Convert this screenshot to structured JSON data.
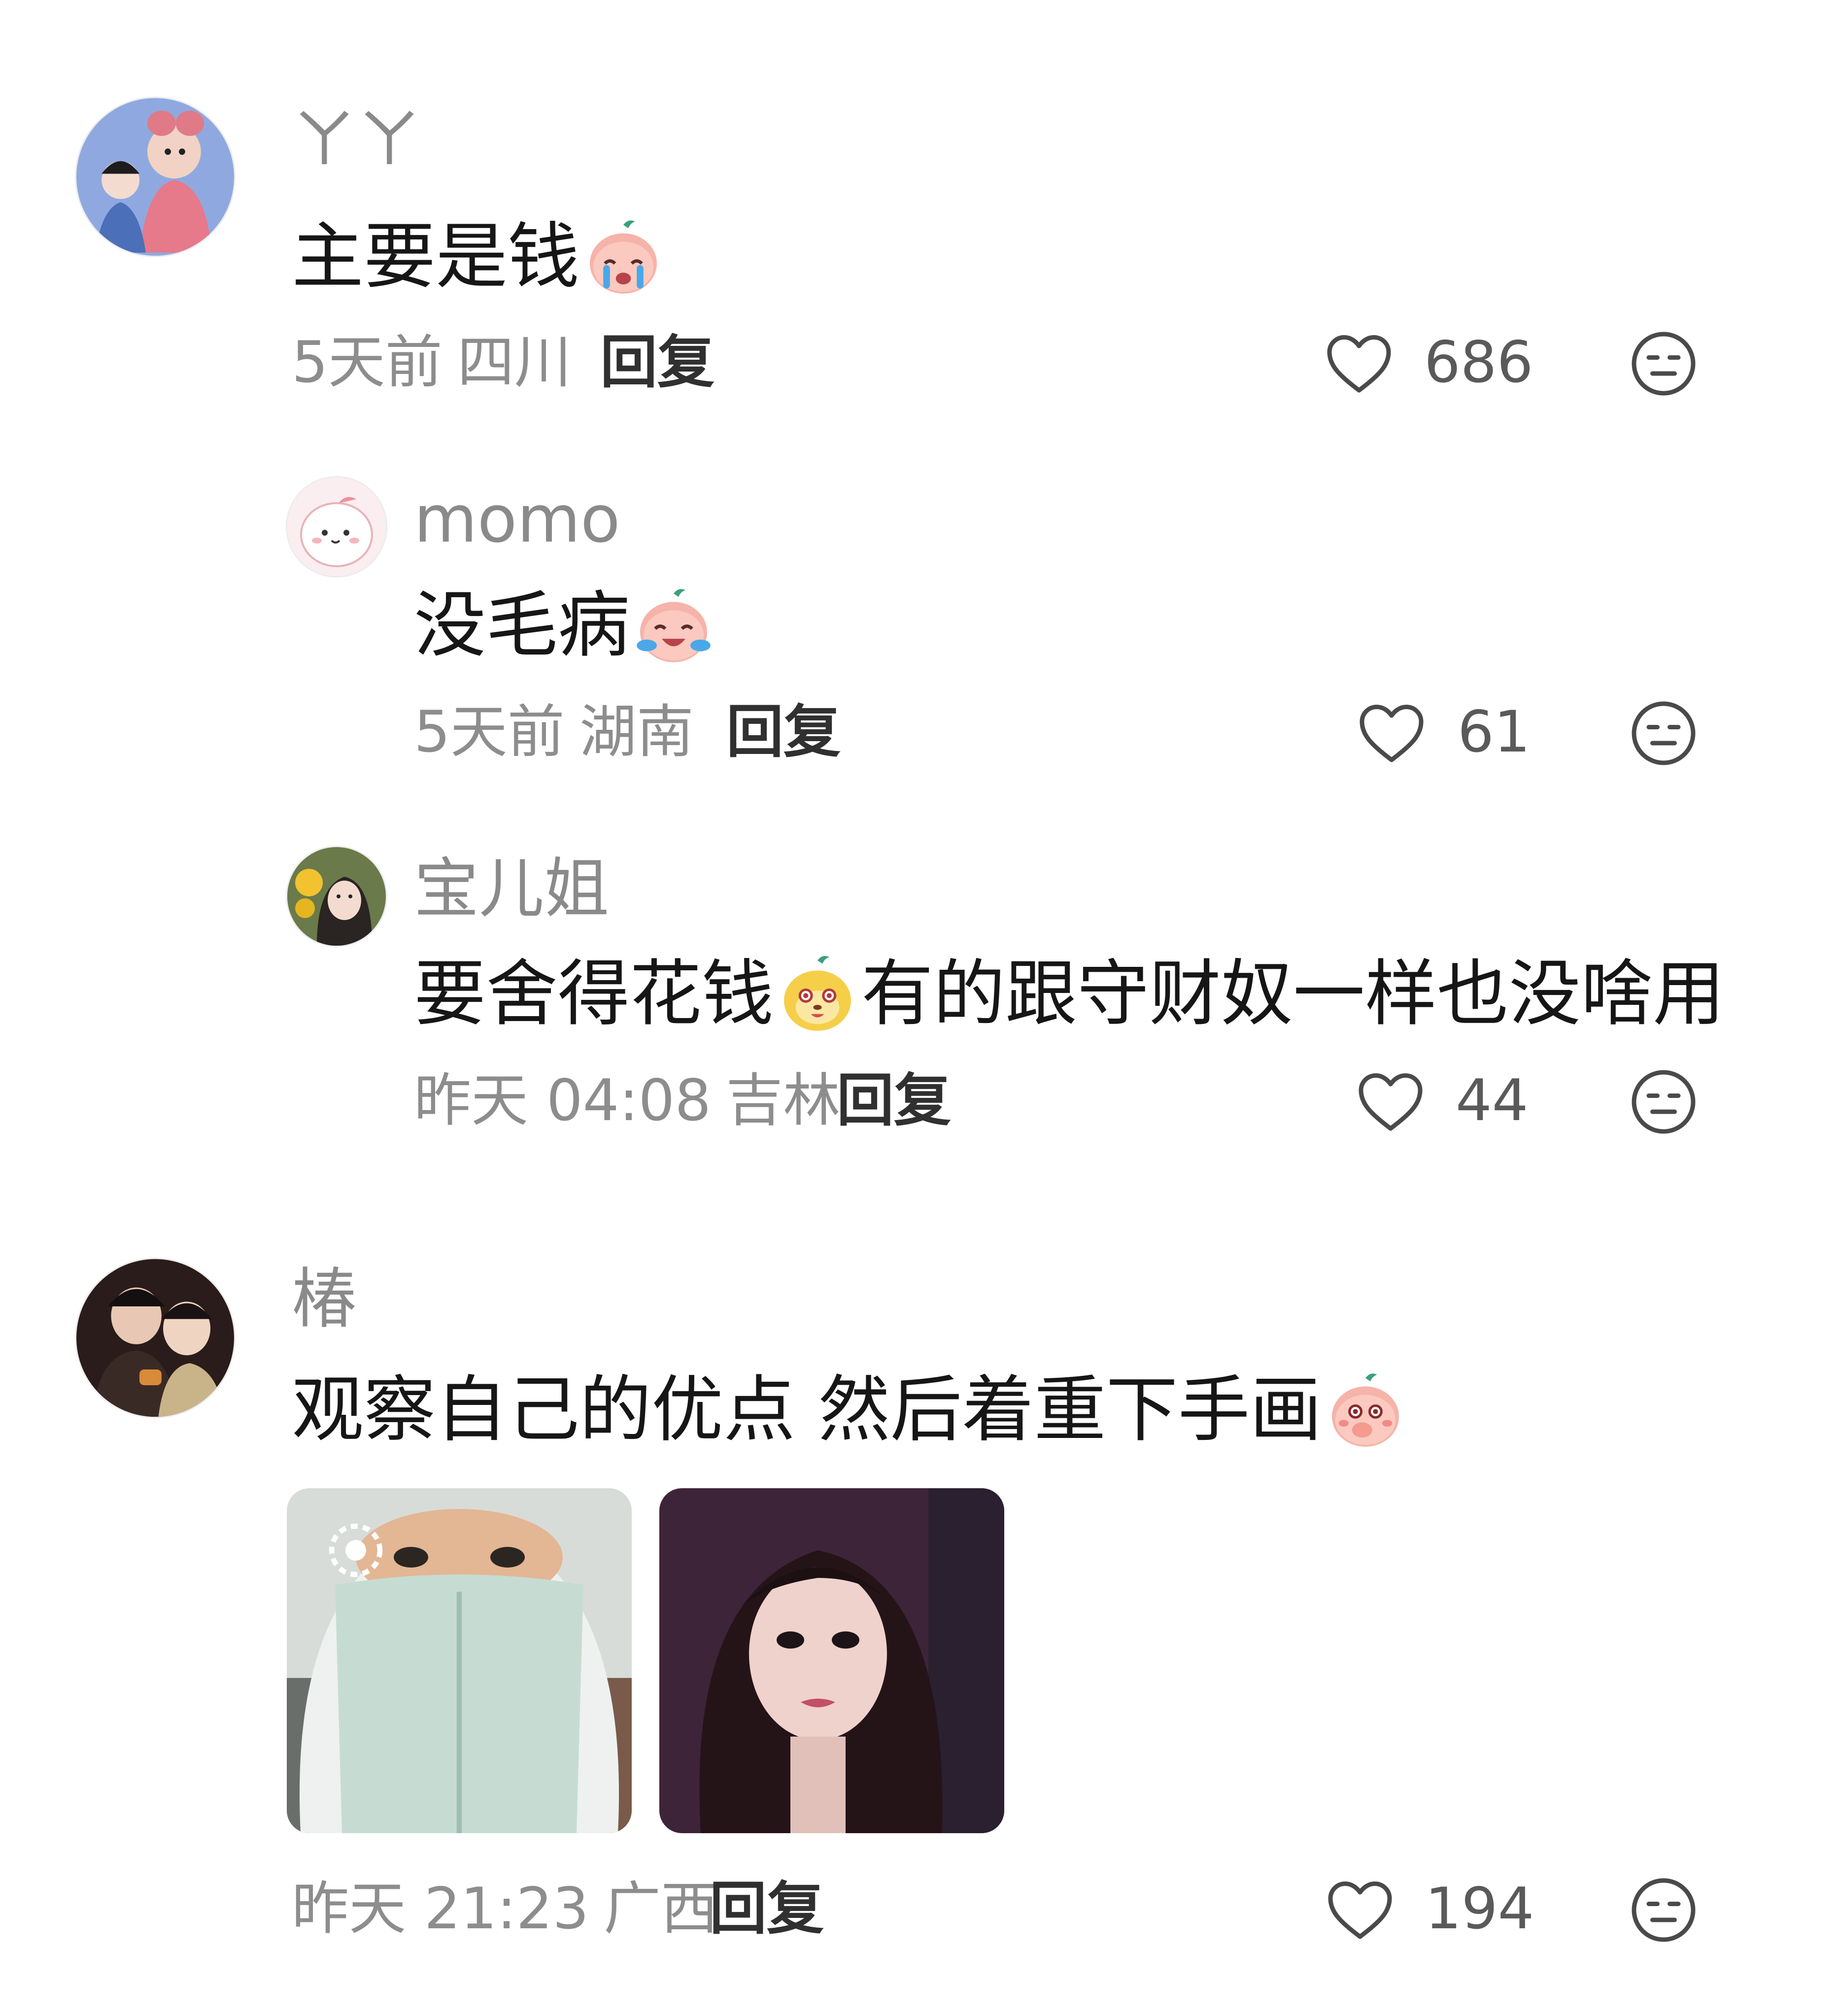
{
  "comments": [
    {
      "username": "ㄚㄚ",
      "text_before_emoji": "主要是钱",
      "emoji_name": "crying-peach-emoji",
      "text_after_emoji": "",
      "time": "5天前",
      "location": "四川",
      "reply_label": "回复",
      "like_count": "686",
      "replies": [
        {
          "username": "momo",
          "text_before_emoji": "没毛病",
          "emoji_name": "laughing-tears-peach-emoji",
          "text_after_emoji": "",
          "time": "5天前",
          "location": "湖南",
          "reply_label": "回复",
          "like_count": "61"
        },
        {
          "username": "宝儿姐",
          "text_before_emoji": "要舍得花钱",
          "emoji_name": "dog-face-emoji",
          "text_after_emoji": "有的跟守财奴一样也没啥用",
          "time": "昨天 04:08",
          "location": "吉林",
          "reply_label": "回复",
          "like_count": "44"
        }
      ]
    },
    {
      "username": "椿",
      "text_before_emoji": "观察自己的优点 然后着重下手画",
      "emoji_name": "shy-peach-emoji",
      "text_after_emoji": "",
      "time": "昨天 21:23",
      "location": "广西",
      "reply_label": "回复",
      "like_count": "194",
      "photos": [
        "masked-selfie-photo",
        "makeup-selfie-photo"
      ]
    }
  ],
  "icons": {
    "like": "heart-outline-icon",
    "dislike": "meh-face-icon"
  },
  "colors": {
    "username": "#8a8a8a",
    "text": "#161616",
    "meta": "#8d8d8d",
    "icon": "#4a4a4a"
  }
}
